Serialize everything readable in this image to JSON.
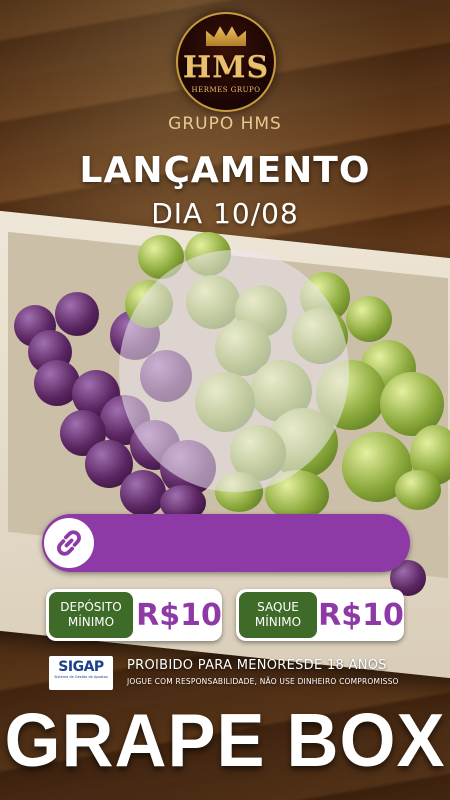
{
  "logo": {
    "text": "HMS",
    "subtitle": "HERMES GRUPO"
  },
  "brand": "GRUPO HMS",
  "announcement": {
    "headline": "LANÇAMENTO",
    "date": "DIA 10/08"
  },
  "deposit": {
    "label_line1": "DEPÓSITO",
    "label_line2": "MÍNIMO",
    "value": "R$10"
  },
  "withdraw": {
    "label_line1": "SAQUE",
    "label_line2": "MÍNIMO",
    "value": "R$10"
  },
  "sigap": {
    "title": "SIGAP",
    "subtitle": "Sistema de Gestão de Apostas"
  },
  "warning": {
    "line1": "PROIBIDO PARA MENORESDE 18 ANOS",
    "line2": "JOGUE COM RESPONSABILIDADE,   NÃO USE DINHEIRO COMPROMISSO"
  },
  "game_title": "GRAPE BOX",
  "colors": {
    "accent_purple": "#8e3aa6",
    "label_green": "#3e6b27",
    "gold": "#e8c070"
  },
  "icons": {
    "link": "link-icon",
    "crown": "crown-icon"
  }
}
